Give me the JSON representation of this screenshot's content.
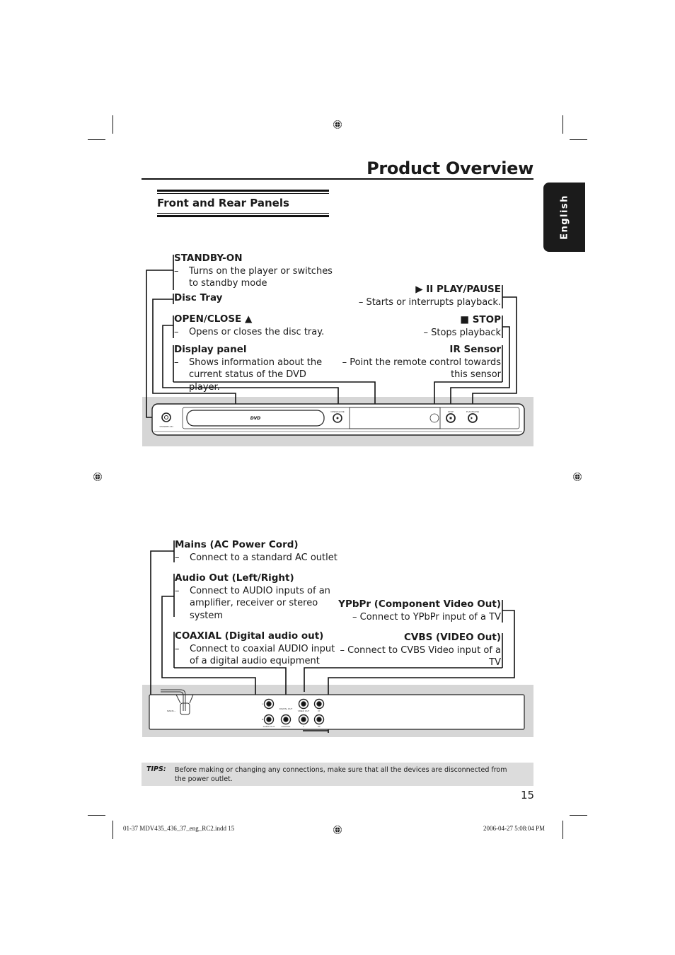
{
  "page": {
    "title": "Product Overview",
    "section_heading": "Front and Rear Panels",
    "language_tab": "English",
    "page_number": "15"
  },
  "front_panel": {
    "left_callouts": [
      {
        "heading": "STANDBY-ON",
        "dash": "–",
        "description": "Turns on the player or switches to standby mode"
      },
      {
        "heading": "Disc Tray",
        "dash": "",
        "description": ""
      },
      {
        "heading": "OPEN/CLOSE ▲",
        "dash": "–",
        "description": "Opens or closes the disc tray."
      },
      {
        "heading": "Display panel",
        "dash": "–",
        "description": "Shows information about the current status of the DVD player."
      }
    ],
    "right_callouts": [
      {
        "heading": "▶ II  PLAY/PAUSE",
        "description": "– Starts or interrupts playback."
      },
      {
        "heading": "■ STOP",
        "description": "– Stops playback"
      },
      {
        "heading": "IR Sensor",
        "description": "– Point the remote control towards this sensor"
      }
    ],
    "device_labels": {
      "standby": "STANDBY-ON",
      "logo": "DVD",
      "open_close": "OPEN/CLOSE",
      "stop": "STOP",
      "play_pause": "PLAY/PAUSE"
    }
  },
  "rear_panel": {
    "left_callouts": [
      {
        "heading": "Mains (AC Power Cord)",
        "dash": "–",
        "description": "Connect to a standard AC outlet"
      },
      {
        "heading": "Audio Out (Left/Right)",
        "dash": "–",
        "description": "Connect to AUDIO inputs of an amplifier, receiver or stereo system"
      },
      {
        "heading": "COAXIAL (Digital audio out)",
        "dash": "–",
        "description": "Connect to coaxial AUDIO input of a digital audio equipment"
      }
    ],
    "right_callouts": [
      {
        "heading": "YPbPr (Component Video Out)",
        "description": "– Connect to YPbPr input of a TV"
      },
      {
        "heading": "CVBS (VIDEO Out)",
        "description": "– Connect to CVBS Video input of a TV"
      }
    ],
    "device_labels": {
      "mains": "MAINS ~",
      "audio_out": "AUDIO OUT",
      "digital_out": "DIGITAL OUT",
      "coaxial": "COAXIAL",
      "video_out": "VIDEO OUT",
      "pr": "Pr",
      "y": "Y",
      "pb": "Pb",
      "l": "L",
      "r": "R"
    }
  },
  "tips": {
    "label": "TIPS:",
    "text": "Before making or changing any connections, make sure that all the devices are disconnected from the power outlet."
  },
  "slug": {
    "file": "01-37 MDV435_436_37_eng_RC2.indd   15",
    "timestamp": "2006-04-27   5:08:04 PM"
  }
}
